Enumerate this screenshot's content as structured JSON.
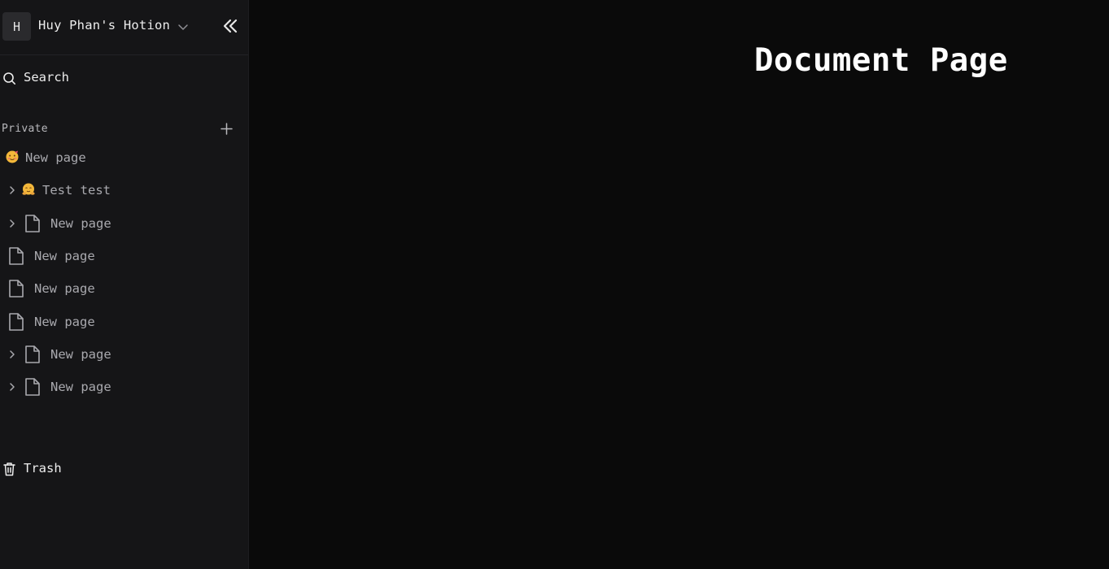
{
  "sidebar": {
    "workspace": {
      "avatar_letter": "H",
      "name": "Huy Phan's Hotion"
    },
    "search_label": "Search",
    "section_label": "Private",
    "pages": [
      {
        "label": "New page",
        "icon": "emoji-face-icon",
        "has_chevron": false
      },
      {
        "label": "Test test",
        "icon": "emoji-hug-icon",
        "has_chevron": true
      },
      {
        "label": "New page",
        "icon": "document-icon",
        "has_chevron": true
      },
      {
        "label": "New page",
        "icon": "document-icon",
        "has_chevron": false
      },
      {
        "label": "New page",
        "icon": "document-icon",
        "has_chevron": false
      },
      {
        "label": "New page",
        "icon": "document-icon",
        "has_chevron": false
      },
      {
        "label": "New page",
        "icon": "document-icon",
        "has_chevron": true
      },
      {
        "label": "New page",
        "icon": "document-icon",
        "has_chevron": true
      }
    ],
    "trash_label": "Trash"
  },
  "main": {
    "title": "Document Page"
  },
  "colors": {
    "sidebar_bg": "#151517",
    "main_bg": "#0a0a0a",
    "text_primary": "#ededed",
    "text_secondary": "#a9a9ae"
  }
}
